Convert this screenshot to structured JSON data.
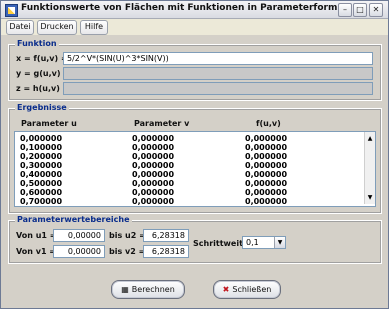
{
  "window": {
    "title": "Funktionswerte von Flächen mit Funktionen in Parameterform"
  },
  "titlebar_buttons": {
    "minimize": "–",
    "maximize": "□",
    "close": "✕"
  },
  "menu": [
    "Datei",
    "Drucken",
    "Hilfe"
  ],
  "funktion": {
    "legend": "Funktion",
    "x_label": "x = f(u,v) =",
    "x_value": "5/2^V*(SIN(U)^3*SIN(V))",
    "y_label": "y = g(u,v) =",
    "y_value": "",
    "z_label": "z = h(u,v) =",
    "z_value": ""
  },
  "ergebnisse": {
    "legend": "Ergebnisse",
    "headers": [
      "Parameter u",
      "Parameter v",
      "f(u,v)"
    ],
    "rows": [
      [
        "0,000000",
        "0,000000",
        "0,000000"
      ],
      [
        "0,100000",
        "0,000000",
        "0,000000"
      ],
      [
        "0,200000",
        "0,000000",
        "0,000000"
      ],
      [
        "0,300000",
        "0,000000",
        "0,000000"
      ],
      [
        "0,400000",
        "0,000000",
        "0,000000"
      ],
      [
        "0,500000",
        "0,000000",
        "0,000000"
      ],
      [
        "0,600000",
        "0,000000",
        "0,000000"
      ],
      [
        "0,700000",
        "0,000000",
        "0,000000"
      ]
    ]
  },
  "parameter": {
    "legend": "Parameterwertebereiche",
    "u1_label": "Von u1 =",
    "u1_value": "0,00000",
    "u2_label": "bis  u2 =",
    "u2_value": "6,28318",
    "v1_label": "Von v1 =",
    "v1_value": "0,00000",
    "v2_label": "bis  v2 =",
    "v2_value": "6,28318",
    "schrittweite_label": "Schrittweite:",
    "schrittweite_value": "0,1"
  },
  "buttons": {
    "berechnen": "Berechnen",
    "schliessen": "Schließen"
  },
  "icons": {
    "calculator": "calculator-icon",
    "close": "close-x-icon"
  }
}
